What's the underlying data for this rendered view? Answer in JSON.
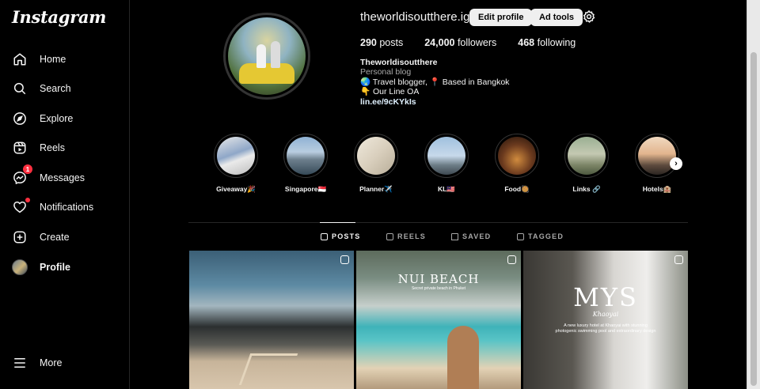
{
  "app": {
    "logo": "Instagram"
  },
  "sidebar": {
    "items": [
      {
        "label": "Home",
        "icon": "home-icon"
      },
      {
        "label": "Search",
        "icon": "search-icon"
      },
      {
        "label": "Explore",
        "icon": "compass-icon"
      },
      {
        "label": "Reels",
        "icon": "reels-icon"
      },
      {
        "label": "Messages",
        "icon": "messenger-icon",
        "badge": "1"
      },
      {
        "label": "Notifications",
        "icon": "heart-icon"
      },
      {
        "label": "Create",
        "icon": "plus-square-icon"
      },
      {
        "label": "Profile",
        "icon": "avatar",
        "active": true
      }
    ],
    "more": "More"
  },
  "profile": {
    "username": "theworldisoutthere.ig",
    "edit_label": "Edit profile",
    "ad_tools_label": "Ad tools",
    "stats": {
      "posts_count": "290",
      "posts_label": "posts",
      "followers_count": "24,000",
      "followers_label": "followers",
      "following_count": "468",
      "following_label": "following"
    },
    "bio": {
      "name": "Theworldisoutthere",
      "category": "Personal blog",
      "line1": "🌏 Travel blogger, 📍 Based in Bangkok",
      "line2": "👇 Our Line OA",
      "link": "lin.ee/9cKYkIs"
    }
  },
  "highlights": [
    {
      "label": "Giveaway🎉"
    },
    {
      "label": "Singapore🇸🇬"
    },
    {
      "label": "Planner✈️"
    },
    {
      "label": "KL🇲🇾"
    },
    {
      "label": "Food🥘"
    },
    {
      "label": "Links 🔗"
    },
    {
      "label": "Hotels🏨"
    }
  ],
  "tabs": {
    "posts": "POSTS",
    "reels": "REELS",
    "saved": "SAVED",
    "tagged": "TAGGED"
  },
  "posts": [
    {
      "overlay_title": "",
      "overlay_sub": ""
    },
    {
      "overlay_title": "NUI BEACH",
      "overlay_sub": "Secret private beach in Phuket"
    },
    {
      "overlay_title": "MYS",
      "overlay_sub": "Khaoyai",
      "overlay_desc": "A new luxury hotel at Khaoyai with stunning photogenic swimming pool and extraordinary design"
    }
  ]
}
